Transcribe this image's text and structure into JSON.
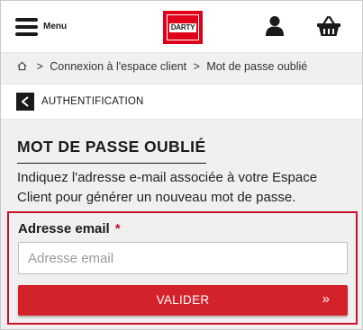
{
  "header": {
    "menu_label": "Menu",
    "logo_text": "DARTY",
    "user_icon": "user-icon",
    "basket_icon": "basket-icon"
  },
  "breadcrumb": {
    "home_icon": "home-icon",
    "separator": ">",
    "items": [
      "Connexion à l'espace client",
      "Mot de passe oublié"
    ]
  },
  "auth_bar": {
    "back_icon": "chevron-left-icon",
    "label": "AUTHENTIFICATION"
  },
  "main": {
    "title": "MOT DE PASSE OUBLIÉ",
    "intro": "Indiquez l'adresse e-mail associée à votre Espace Client pour générer un nouveau mot de passe."
  },
  "form": {
    "email_label": "Adresse email",
    "required_mark": "*",
    "email_placeholder": "Adresse email",
    "email_value": "",
    "submit_label": "VALIDER",
    "submit_arrow": "»"
  },
  "colors": {
    "brand_red": "#e1001a",
    "button_red": "#d4222a",
    "border_red": "#c8102e",
    "background": "#f0f0f0"
  }
}
